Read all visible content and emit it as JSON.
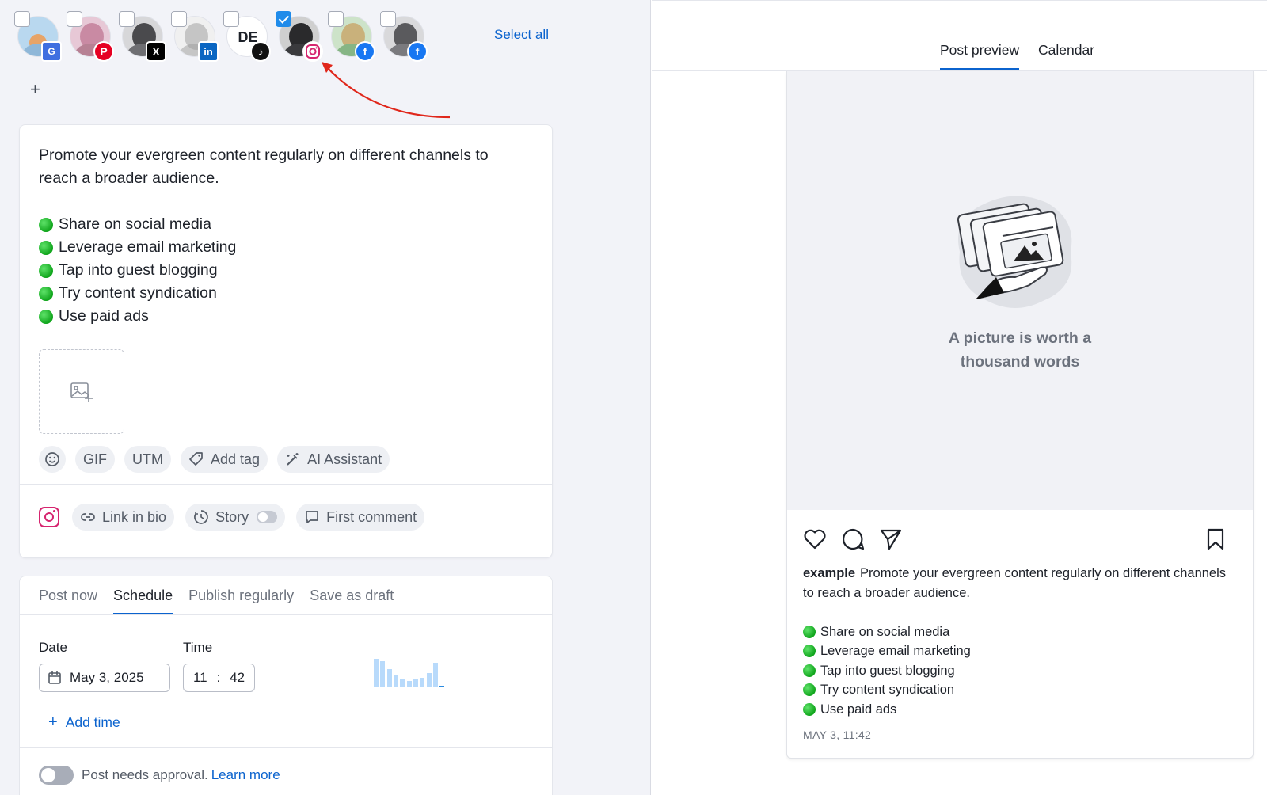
{
  "profiles": [
    {
      "name": "profile-1",
      "network": "google-business",
      "checked": false,
      "avatar_colors": [
        "#b9d8ef",
        "#e7a468"
      ]
    },
    {
      "name": "profile-2",
      "network": "pinterest",
      "checked": false,
      "avatar_colors": [
        "#e7c8d6",
        "#c98aa3"
      ]
    },
    {
      "name": "profile-3",
      "network": "x",
      "checked": false,
      "avatar_colors": [
        "#d7d7d9",
        "#4a4a4d"
      ]
    },
    {
      "name": "profile-4",
      "network": "linkedin",
      "checked": false,
      "avatar_colors": [
        "#f0f0f0",
        "#9b9b9b"
      ]
    },
    {
      "name": "profile-5",
      "network": "tiktok",
      "checked": false,
      "avatar_text": "DE"
    },
    {
      "name": "profile-6",
      "network": "instagram",
      "checked": true,
      "avatar_colors": [
        "#cfcfcf",
        "#2a2a2c"
      ]
    },
    {
      "name": "profile-7",
      "network": "facebook",
      "checked": false,
      "avatar_colors": [
        "#cde3c9",
        "#c79b5a"
      ]
    },
    {
      "name": "profile-8",
      "network": "facebook",
      "checked": false,
      "avatar_colors": [
        "#d9d9db",
        "#5a5a5d"
      ]
    }
  ],
  "header": {
    "select_all": "Select all",
    "add_profile": "+"
  },
  "post": {
    "intro": "Promote your evergreen content regularly on different channels to reach a broader audience.",
    "bullets": [
      "Share on social media",
      "Leverage email marketing",
      "Tap into guest blogging",
      "Try content syndication",
      "Use paid ads"
    ]
  },
  "tools": {
    "gif": "GIF",
    "utm": "UTM",
    "add_tag": "Add tag",
    "ai": "AI Assistant"
  },
  "ig_tools": {
    "link_in_bio": "Link in bio",
    "story": "Story",
    "first_comment": "First comment"
  },
  "schedule": {
    "tabs": [
      "Post now",
      "Schedule",
      "Publish regularly",
      "Save as draft"
    ],
    "active_tab": "Schedule",
    "date_label": "Date",
    "time_label": "Time",
    "date_value": "May 3, 2025",
    "hour": "11",
    "separator": ":",
    "minute": "42",
    "add_time": "Add time",
    "approval_text": "Post needs approval.",
    "learn_more": "Learn more",
    "activity_histogram": [
      34,
      31,
      22,
      14,
      9,
      8,
      10,
      11,
      17,
      29,
      2,
      0,
      0,
      0,
      0,
      0,
      0,
      0,
      0,
      0,
      0,
      0,
      0,
      0
    ]
  },
  "preview": {
    "tabs": [
      "Post preview",
      "Calendar"
    ],
    "active_tab": "Post preview",
    "placeholder_line1": "A picture is worth a",
    "placeholder_line2": "thousand words",
    "username": "example",
    "caption_intro": "Promote your evergreen content regularly on different channels to reach a broader audience.",
    "bullets": [
      "Share on social media",
      "Leverage email marketing",
      "Tap into guest blogging",
      "Try content syndication",
      "Use paid ads"
    ],
    "timestamp": "MAY 3, 11:42"
  },
  "colors": {
    "accent": "#0b63ce",
    "instagram": "#d6256f",
    "annotation_arrow": "#e0271b"
  }
}
